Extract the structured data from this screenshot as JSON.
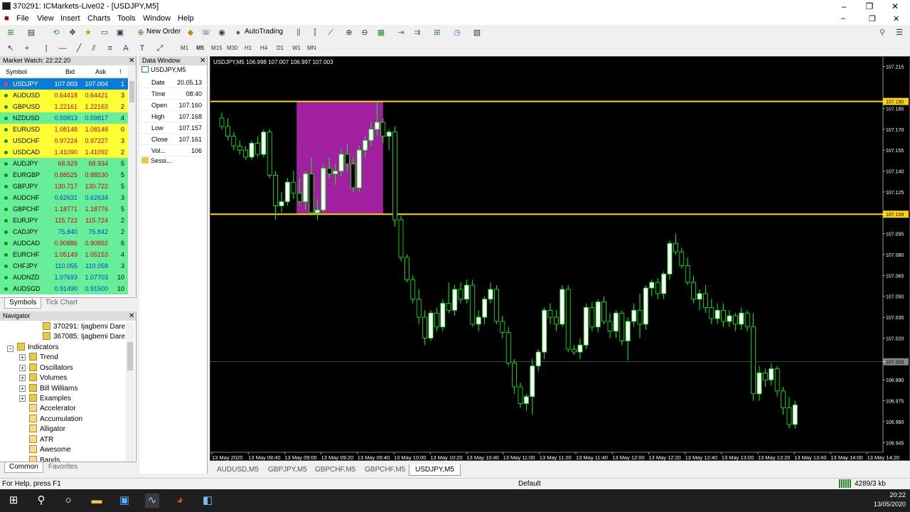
{
  "window": {
    "title": "370291: ICMarkets-Live02 - [USDJPY,M5]"
  },
  "menu": [
    "File",
    "View",
    "Insert",
    "Charts",
    "Tools",
    "Window",
    "Help"
  ],
  "toolbar": {
    "new_order": "New Order",
    "autotrading": "AutoTrading",
    "timeframes": [
      "M1",
      "M5",
      "M15",
      "M30",
      "H1",
      "H4",
      "D1",
      "W1",
      "MN"
    ],
    "active_timeframe": "M5"
  },
  "market_watch": {
    "title": "Market Watch: 22:22:20",
    "columns": {
      "symbol": "Symbol",
      "bid": "Bid",
      "ask": "Ask",
      "spread": "!"
    },
    "rows": [
      {
        "symbol": "USDJPY",
        "bid": "107.003",
        "ask": "107.004",
        "spread": "1",
        "color": "#0a7bd7",
        "textcolor": "#ffffff"
      },
      {
        "symbol": "AUDUSD",
        "bid": "0.64418",
        "ask": "0.64421",
        "spread": "3",
        "color": "#ffff33",
        "textcolor": "#d00000"
      },
      {
        "symbol": "GBPUSD",
        "bid": "1.22161",
        "ask": "1.22163",
        "spread": "2",
        "color": "#ffff33",
        "textcolor": "#d00000"
      },
      {
        "symbol": "NZDUSD",
        "bid": "0.59813",
        "ask": "0.59817",
        "spread": "4",
        "color": "#66ee99",
        "textcolor": "#0044cc"
      },
      {
        "symbol": "EURUSD",
        "bid": "1.08148",
        "ask": "1.08148",
        "spread": "0",
        "color": "#ffff33",
        "textcolor": "#d00000"
      },
      {
        "symbol": "USDCHF",
        "bid": "0.97224",
        "ask": "0.97227",
        "spread": "3",
        "color": "#ffff33",
        "textcolor": "#d00000"
      },
      {
        "symbol": "USDCAD",
        "bid": "1.41090",
        "ask": "1.41092",
        "spread": "2",
        "color": "#ffff33",
        "textcolor": "#d00000"
      },
      {
        "symbol": "AUDJPY",
        "bid": "68.929",
        "ask": "68.934",
        "spread": "5",
        "color": "#66ee99",
        "textcolor": "#d00000"
      },
      {
        "symbol": "EURGBP",
        "bid": "0.88525",
        "ask": "0.88530",
        "spread": "5",
        "color": "#66ee99",
        "textcolor": "#d00000"
      },
      {
        "symbol": "GBPJPY",
        "bid": "130.717",
        "ask": "130.722",
        "spread": "5",
        "color": "#66ee99",
        "textcolor": "#d00000"
      },
      {
        "symbol": "AUDCHF",
        "bid": "0.62631",
        "ask": "0.62634",
        "spread": "3",
        "color": "#66ee99",
        "textcolor": "#0044cc"
      },
      {
        "symbol": "GBPCHF",
        "bid": "1.18771",
        "ask": "1.18776",
        "spread": "5",
        "color": "#66ee99",
        "textcolor": "#d00000"
      },
      {
        "symbol": "EURJPY",
        "bid": "115.722",
        "ask": "115.724",
        "spread": "2",
        "color": "#66ee99",
        "textcolor": "#d00000"
      },
      {
        "symbol": "CADJPY",
        "bid": "75.840",
        "ask": "75.842",
        "spread": "2",
        "color": "#66ee99",
        "textcolor": "#0044cc"
      },
      {
        "symbol": "AUDCAD",
        "bid": "0.90886",
        "ask": "0.90892",
        "spread": "6",
        "color": "#66ee99",
        "textcolor": "#d00000"
      },
      {
        "symbol": "EURCHF",
        "bid": "1.05149",
        "ask": "1.05153",
        "spread": "4",
        "color": "#66ee99",
        "textcolor": "#d00000"
      },
      {
        "symbol": "CHFJPY",
        "bid": "110.055",
        "ask": "110.058",
        "spread": "3",
        "color": "#66ee99",
        "textcolor": "#0044cc"
      },
      {
        "symbol": "AUDNZD",
        "bid": "1.07693",
        "ask": "1.07703",
        "spread": "10",
        "color": "#66ee99",
        "textcolor": "#0044cc"
      },
      {
        "symbol": "AUDSGD",
        "bid": "0.91490",
        "ask": "0.91500",
        "spread": "10",
        "color": "#66ee99",
        "textcolor": "#0044cc"
      }
    ],
    "tabs": [
      "Symbols",
      "Tick Chart"
    ]
  },
  "navigator": {
    "title": "Navigator",
    "accounts": [
      "370291: Ijagbemi Dare",
      "367085: Ijagbemi Dare"
    ],
    "indicators_label": "Indicators",
    "folders": [
      "Trend",
      "Oscillators",
      "Volumes",
      "Bill Williams",
      "Examples"
    ],
    "items": [
      "Accelerator",
      "Accumulation",
      "Alligator",
      "ATR",
      "Awesome",
      "Bands"
    ],
    "tabs": [
      "Common",
      "Favorites"
    ]
  },
  "data_window": {
    "title": "Data Window",
    "symbol": "USDJPY,M5",
    "rows": [
      {
        "label": "Date",
        "value": "20.05.13"
      },
      {
        "label": "Time",
        "value": "08:40"
      },
      {
        "label": "Open",
        "value": "107.160"
      },
      {
        "label": "High",
        "value": "107.168"
      },
      {
        "label": "Low",
        "value": "107.157"
      },
      {
        "label": "Close",
        "value": "107.161"
      },
      {
        "label": "Vol...",
        "value": "106"
      }
    ],
    "session": "Sessi..."
  },
  "chart": {
    "header": "USDJPY,M5  106.998 107.007 106.997 107.003",
    "price_labels": [
      "107.215",
      "107.190",
      "107.185",
      "107.170",
      "107.155",
      "107.140",
      "107.125",
      "107.109",
      "107.095",
      "107.080",
      "107.065",
      "107.050",
      "107.035",
      "107.020",
      "107.003",
      "106.990",
      "106.975",
      "106.960",
      "106.945"
    ],
    "time_labels": [
      "13 May 2020",
      "13 May 08:40",
      "13 May 09:00",
      "13 May 09:20",
      "13 May 09:40",
      "13 May 10:00",
      "13 May 10:20",
      "13 May 10:40",
      "13 May 11:00",
      "13 May 11:20",
      "13 May 11:40",
      "13 May 12:00",
      "13 May 12:20",
      "13 May 12:40",
      "13 May 13:00",
      "13 May 13:20",
      "13 May 13:40",
      "13 May 14:00",
      "13 May 14:20"
    ],
    "hline_upper": "107.190",
    "hline_lower": "107.109",
    "bid_line": "107.003",
    "colors": {
      "bull": "#ffffff",
      "bear": "#000000",
      "wick": "#00ff00",
      "level": "#ffd700",
      "box": "#a020a0"
    }
  },
  "chart_data": {
    "type": "candlestick",
    "title": "USDJPY,M5",
    "ylim": [
      106.938,
      107.222
    ],
    "candles": [
      [
        107.178,
        107.182,
        107.17,
        107.172
      ],
      [
        107.172,
        107.178,
        107.162,
        107.165
      ],
      [
        107.165,
        107.168,
        107.155,
        107.158
      ],
      [
        107.158,
        107.162,
        107.152,
        107.155
      ],
      [
        107.155,
        107.158,
        107.148,
        107.15
      ],
      [
        107.15,
        107.162,
        107.148,
        107.16
      ],
      [
        107.16,
        107.165,
        107.15,
        107.152
      ],
      [
        107.152,
        107.17,
        107.15,
        107.168
      ],
      [
        107.168,
        107.17,
        107.135,
        107.137
      ],
      [
        107.137,
        107.14,
        107.105,
        107.115
      ],
      [
        107.115,
        107.125,
        107.11,
        107.118
      ],
      [
        107.118,
        107.135,
        107.115,
        107.132
      ],
      [
        107.132,
        107.14,
        107.12,
        107.124
      ],
      [
        107.124,
        107.135,
        107.115,
        107.118
      ],
      [
        107.118,
        107.14,
        107.112,
        107.138
      ],
      [
        107.138,
        107.15,
        107.108,
        107.11
      ],
      [
        107.11,
        107.12,
        107.105,
        107.112
      ],
      [
        107.112,
        107.145,
        107.11,
        107.142
      ],
      [
        107.142,
        107.15,
        107.135,
        107.138
      ],
      [
        107.138,
        107.145,
        107.13,
        107.14
      ],
      [
        107.14,
        107.155,
        107.136,
        107.152
      ],
      [
        107.152,
        107.16,
        107.14,
        107.145
      ],
      [
        107.145,
        107.15,
        107.125,
        107.128
      ],
      [
        107.128,
        107.158,
        107.125,
        107.155
      ],
      [
        107.155,
        107.165,
        107.15,
        107.162
      ],
      [
        107.162,
        107.175,
        107.158,
        107.17
      ],
      [
        107.17,
        107.19,
        107.165,
        107.175
      ],
      [
        107.175,
        107.178,
        107.16,
        107.165
      ],
      [
        107.165,
        107.17,
        107.155,
        107.168
      ],
      [
        107.168,
        107.172,
        107.1,
        107.105
      ],
      [
        107.105,
        107.108,
        107.075,
        107.078
      ],
      [
        107.078,
        107.08,
        107.06,
        107.062
      ],
      [
        107.062,
        107.065,
        107.045,
        107.048
      ],
      [
        107.048,
        107.055,
        107.03,
        107.035
      ],
      [
        107.035,
        107.04,
        107.015,
        107.02
      ],
      [
        107.02,
        107.04,
        107.018,
        107.038
      ],
      [
        107.038,
        107.042,
        107.025,
        107.028
      ],
      [
        107.028,
        107.048,
        107.025,
        107.045
      ],
      [
        107.045,
        107.06,
        107.038,
        107.04
      ],
      [
        107.04,
        107.058,
        107.036,
        107.055
      ],
      [
        107.055,
        107.06,
        107.045,
        107.048
      ],
      [
        107.048,
        107.062,
        107.045,
        107.058
      ],
      [
        107.058,
        107.062,
        107.028,
        107.03
      ],
      [
        107.03,
        107.04,
        107.025,
        107.035
      ],
      [
        107.035,
        107.05,
        107.03,
        107.048
      ],
      [
        107.048,
        107.06,
        107.045,
        107.055
      ],
      [
        107.055,
        107.058,
        107.03,
        107.032
      ],
      [
        107.032,
        107.036,
        107.02,
        107.024
      ],
      [
        107.024,
        107.028,
        107.0,
        107.002
      ],
      [
        107.002,
        107.005,
        106.98,
        106.985
      ],
      [
        106.985,
        106.988,
        106.97,
        106.973
      ],
      [
        106.973,
        106.98,
        106.968,
        106.978
      ],
      [
        106.978,
        107.005,
        106.965,
        107.0
      ],
      [
        107.0,
        107.012,
        106.996,
        107.01
      ],
      [
        107.01,
        107.042,
        107.005,
        107.04
      ],
      [
        107.04,
        107.045,
        107.03,
        107.035
      ],
      [
        107.035,
        107.04,
        107.025,
        107.03
      ],
      [
        107.03,
        107.058,
        107.028,
        107.055
      ],
      [
        107.055,
        107.058,
        107.01,
        107.012
      ],
      [
        107.012,
        107.015,
        107.008,
        107.01
      ],
      [
        107.01,
        107.02,
        107.005,
        107.015
      ],
      [
        107.015,
        107.045,
        107.012,
        107.042
      ],
      [
        107.042,
        107.046,
        107.025,
        107.028
      ],
      [
        107.028,
        107.048,
        107.024,
        107.046
      ],
      [
        107.046,
        107.05,
        107.03,
        107.032
      ],
      [
        107.032,
        107.038,
        107.02,
        107.025
      ],
      [
        107.025,
        107.04,
        107.02,
        107.038
      ],
      [
        107.038,
        107.04,
        107.015,
        107.018
      ],
      [
        107.018,
        107.035,
        107.004,
        107.032
      ],
      [
        107.032,
        107.045,
        107.028,
        107.04
      ],
      [
        107.04,
        107.052,
        107.02,
        107.03
      ],
      [
        107.03,
        107.058,
        107.026,
        107.056
      ],
      [
        107.056,
        107.062,
        107.05,
        107.06
      ],
      [
        107.06,
        107.063,
        107.048,
        107.052
      ],
      [
        107.052,
        107.068,
        107.048,
        107.066
      ],
      [
        107.066,
        107.09,
        107.062,
        107.088
      ],
      [
        107.088,
        107.095,
        107.08,
        107.082
      ],
      [
        107.082,
        107.085,
        107.07,
        107.072
      ],
      [
        107.072,
        107.078,
        107.058,
        107.06
      ],
      [
        107.06,
        107.065,
        107.045,
        107.048
      ],
      [
        107.048,
        107.055,
        107.04,
        107.052
      ],
      [
        107.052,
        107.058,
        107.038,
        107.042
      ],
      [
        107.042,
        107.048,
        107.03,
        107.034
      ],
      [
        107.034,
        107.045,
        107.03,
        107.04
      ],
      [
        107.04,
        107.045,
        107.028,
        107.032
      ],
      [
        107.032,
        107.04,
        107.028,
        107.036
      ],
      [
        107.036,
        107.038,
        107.025,
        107.03
      ],
      [
        107.03,
        107.042,
        107.026,
        107.038
      ],
      [
        107.038,
        107.04,
        107.025,
        107.028
      ],
      [
        107.028,
        107.038,
        106.975,
        106.98
      ],
      [
        106.98,
        107.0,
        106.975,
        106.995
      ],
      [
        106.995,
        106.998,
        106.985,
        106.99
      ],
      [
        106.99,
        107.002,
        106.986,
        106.998
      ],
      [
        106.998,
        107.0,
        106.978,
        106.982
      ],
      [
        106.982,
        106.985,
        106.965,
        106.97
      ],
      [
        106.97,
        106.978,
        106.955,
        106.958
      ],
      [
        106.958,
        106.975,
        106.955,
        106.972
      ]
    ],
    "highlight_box": {
      "x_start": 13,
      "x_end": 27,
      "y_low": 107.109,
      "y_high": 107.19
    }
  },
  "chart_tabs": [
    "AUDUSD,M5",
    "GBPJPY,M5",
    "GBPCHF,M5",
    "GBPCHF,M5",
    "USDJPY,M5"
  ],
  "active_chart_tab": "USDJPY,M5",
  "status": {
    "help": "For Help, press F1",
    "profile": "Default",
    "traffic": "4289/3 kb"
  },
  "taskbar": {
    "time": "20:22",
    "date": "13/05/2020"
  }
}
